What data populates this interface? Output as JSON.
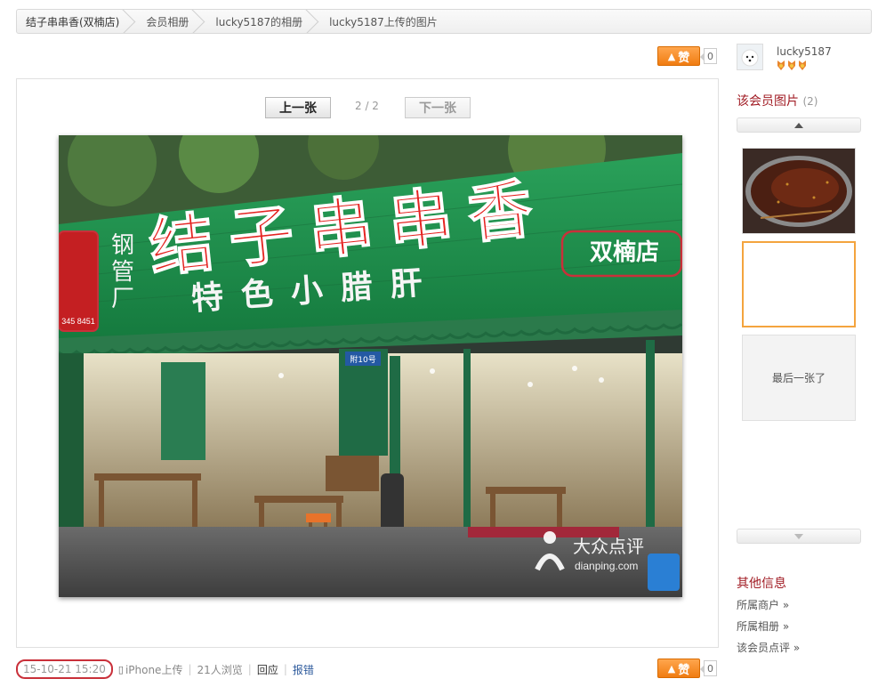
{
  "breadcrumb": [
    "结子串串香(双楠店)",
    "会员相册",
    "lucky5187的相册",
    "lucky5187上传的图片"
  ],
  "like": {
    "label": "赞",
    "count_top": "0",
    "count_bottom": "0"
  },
  "viewer": {
    "prev_label": "上一张",
    "next_label": "下一张",
    "pager": "2 / 2"
  },
  "photo": {
    "sign_main": "结子串串香",
    "sign_branch": "双楠店",
    "sign_sub": "特色小腊肝",
    "sign_left_top": "钢",
    "sign_left_mid": "管",
    "sign_left_bot": "厂",
    "sign_phone": "345 8451",
    "door_number": "附10号",
    "watermark_cn": "大众点评",
    "watermark_en": "dianping.com"
  },
  "footer": {
    "timestamp": "15-10-21 15:20",
    "device": "iPhone上传",
    "views": "21人浏览",
    "reply": "回应",
    "report": "报错"
  },
  "sidebar": {
    "username": "lucky5187",
    "photos_title": "该会员图片",
    "photos_count": "(2)",
    "last_label": "最后一张了",
    "other_title": "其他信息",
    "links": [
      "所属商户 »",
      "所属相册 »",
      "该会员点评 »"
    ]
  },
  "colors": {
    "accent_orange": "#f07c11",
    "title_red": "#a11c24",
    "highlight_red": "#c9303a",
    "sign_green": "#1f8a4c"
  }
}
